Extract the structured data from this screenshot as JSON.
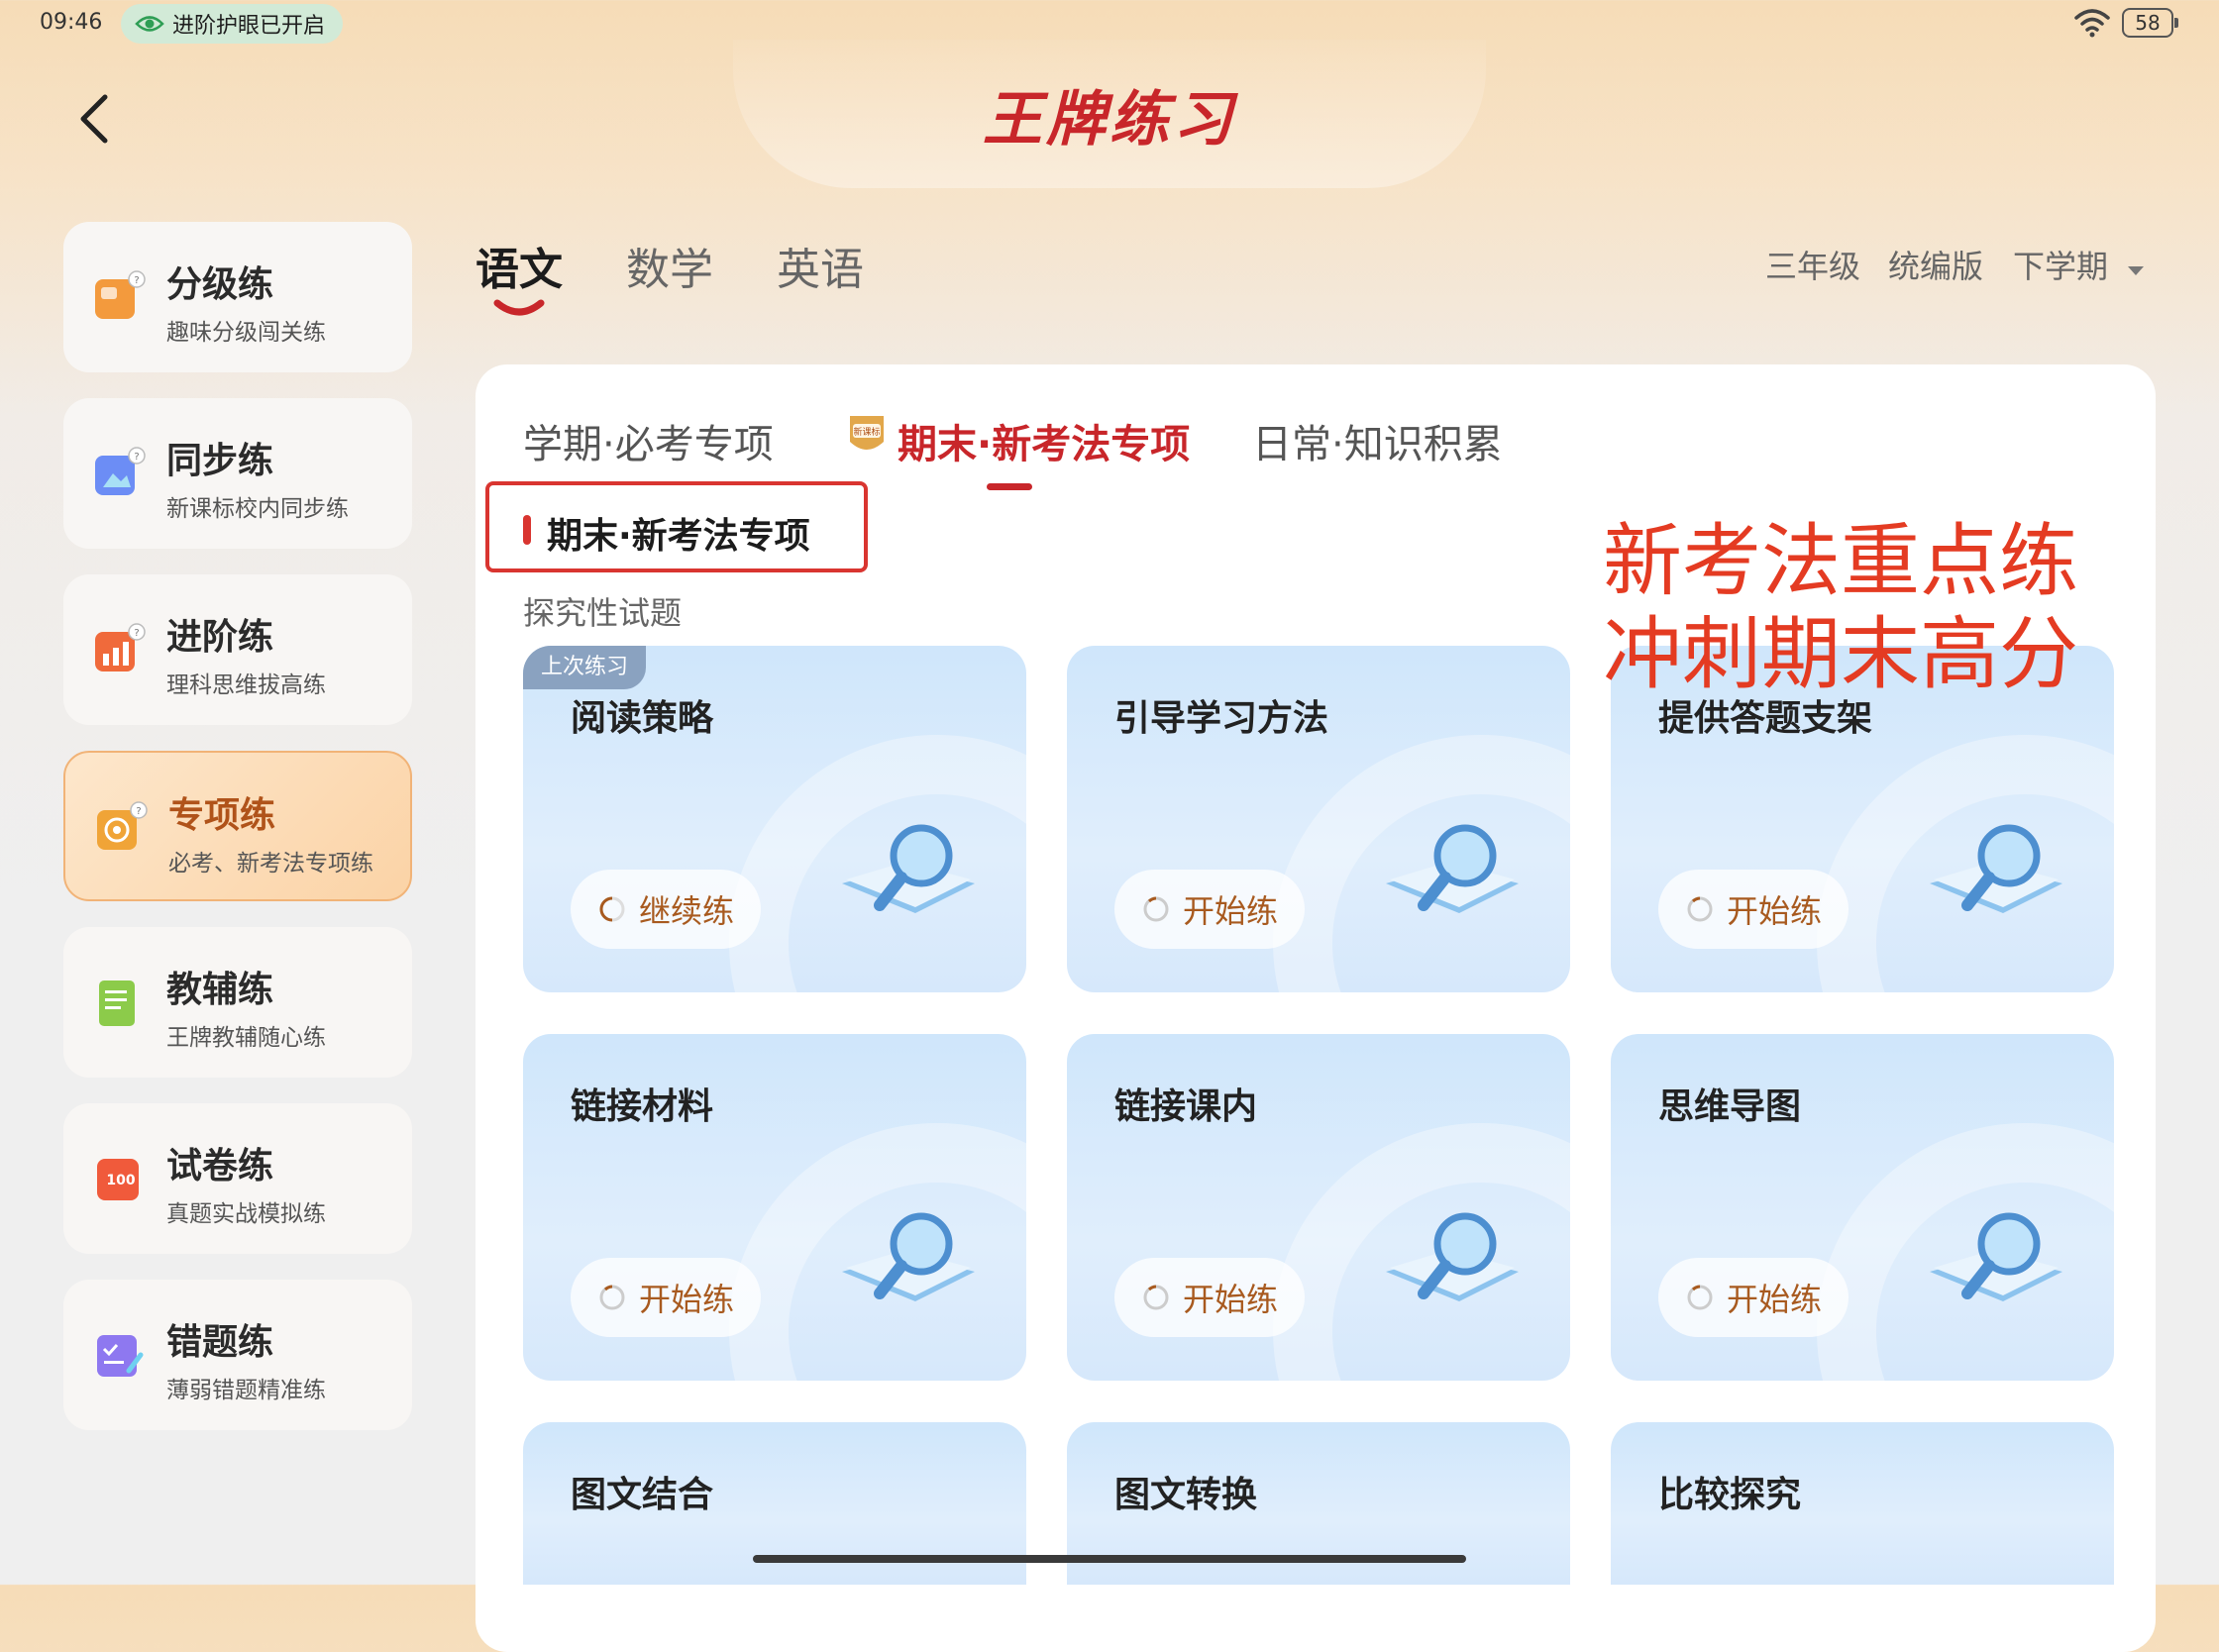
{
  "status_bar": {
    "time": "09:46",
    "eye_care": "进阶护眼已开启",
    "battery": "58"
  },
  "header": {
    "title": "王牌练习"
  },
  "sidebar": {
    "items": [
      {
        "title": "分级练",
        "subtitle": "趣味分级闯关练",
        "icon": "graded-practice-icon",
        "color": "#f39a3d"
      },
      {
        "title": "同步练",
        "subtitle": "新课标校内同步练",
        "icon": "sync-practice-icon",
        "color": "#6c8df5"
      },
      {
        "title": "进阶练",
        "subtitle": "理科思维拔高练",
        "icon": "advanced-practice-icon",
        "color": "#f06a3b"
      },
      {
        "title": "专项练",
        "subtitle": "必考、新考法专项练",
        "icon": "special-practice-icon",
        "color": "#f0a437"
      },
      {
        "title": "教辅练",
        "subtitle": "王牌教辅随心练",
        "icon": "textbook-practice-icon",
        "color": "#8ccb4a"
      },
      {
        "title": "试卷练",
        "subtitle": "真题实战模拟练",
        "icon": "exam-paper-icon",
        "color": "#f05a3b"
      },
      {
        "title": "错题练",
        "subtitle": "薄弱错题精准练",
        "icon": "mistake-practice-icon",
        "color": "#8e78f0"
      }
    ]
  },
  "subject_tabs": [
    "语文",
    "数学",
    "英语"
  ],
  "filters": {
    "grade": "三年级",
    "edition": "统编版",
    "semester": "下学期"
  },
  "sub_tabs": [
    "学期·必考专项",
    "期末·新考法专项",
    "日常·知识积累"
  ],
  "sub_tab_badge": "新课标",
  "section": {
    "title": "期末·新考法专项",
    "subtitle": "探究性试题"
  },
  "promo": {
    "line1": "新考法重点练",
    "line2": "冲刺期末高分"
  },
  "cards": [
    {
      "title": "阅读策略",
      "button": "继续练",
      "tag": "上次练习"
    },
    {
      "title": "引导学习方法",
      "button": "开始练"
    },
    {
      "title": "提供答题支架",
      "button": "开始练"
    },
    {
      "title": "链接材料",
      "button": "开始练"
    },
    {
      "title": "链接课内",
      "button": "开始练"
    },
    {
      "title": "思维导图",
      "button": "开始练"
    },
    {
      "title": "图文结合"
    },
    {
      "title": "图文转换"
    },
    {
      "title": "比较探究"
    }
  ],
  "colors": {
    "brand_red": "#c8262a",
    "annotation_red": "#e43b22",
    "card_blue": "#cfe6fb",
    "button_text": "#a85a1f"
  }
}
